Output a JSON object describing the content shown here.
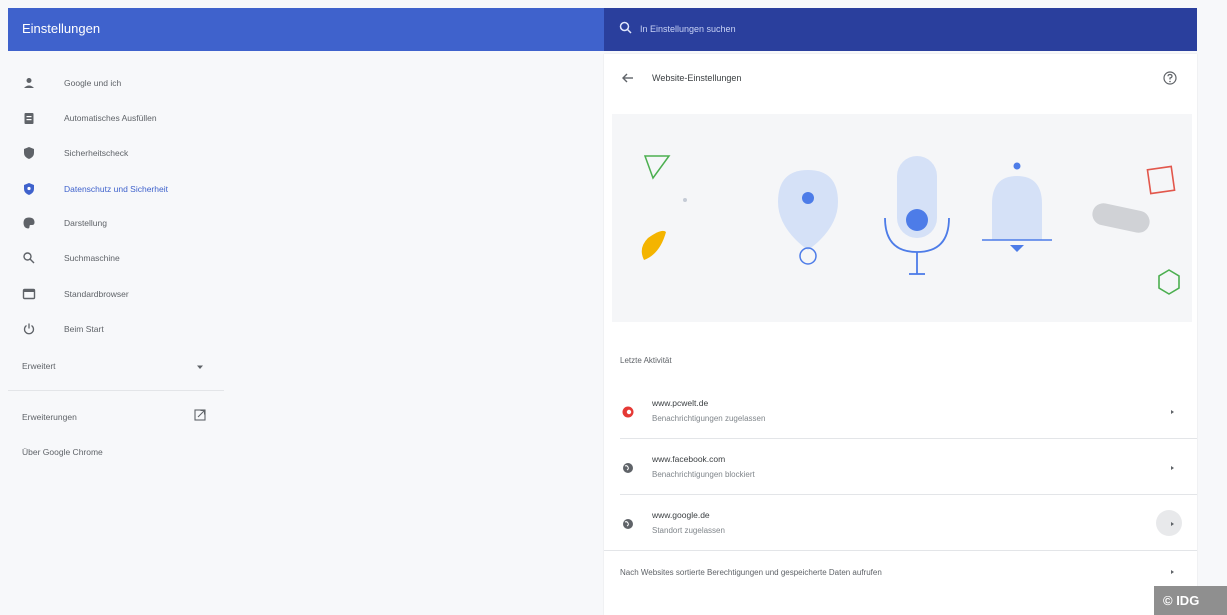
{
  "header": {
    "title": "Einstellungen",
    "search_placeholder": "In Einstellungen suchen"
  },
  "sidebar": {
    "items": [
      {
        "label": "Google und ich",
        "icon": "person-icon"
      },
      {
        "label": "Automatisches Ausfüllen",
        "icon": "clipboard-icon"
      },
      {
        "label": "Sicherheitscheck",
        "icon": "shield-icon"
      },
      {
        "label": "Datenschutz und Sicherheit",
        "icon": "shield-lock-icon",
        "active": true
      },
      {
        "label": "Darstellung",
        "icon": "palette-icon"
      },
      {
        "label": "Suchmaschine",
        "icon": "search-icon"
      },
      {
        "label": "Standardbrowser",
        "icon": "browser-icon"
      },
      {
        "label": "Beim Start",
        "icon": "power-icon"
      }
    ],
    "advanced": "Erweitert",
    "extensions": "Erweiterungen",
    "about": "Über Google Chrome"
  },
  "panel": {
    "title": "Website-Einstellungen",
    "section_title": "Letzte Aktivität",
    "rows": [
      {
        "site": "www.pcwelt.de",
        "status": "Benachrichtigungen zugelassen"
      },
      {
        "site": "www.facebook.com",
        "status": "Benachrichtigungen blockiert"
      },
      {
        "site": "www.google.de",
        "status": "Standort zugelassen"
      }
    ],
    "bottom_link": "Nach Websites sortierte Berechtigungen und gespeicherte Daten aufrufen"
  },
  "watermark": "© IDG",
  "colors": {
    "accent": "#3f62cc",
    "search_bar": "#2a3f9d",
    "illustration_blue": "#4d7ce8",
    "illustration_light": "#d5e1f7"
  }
}
